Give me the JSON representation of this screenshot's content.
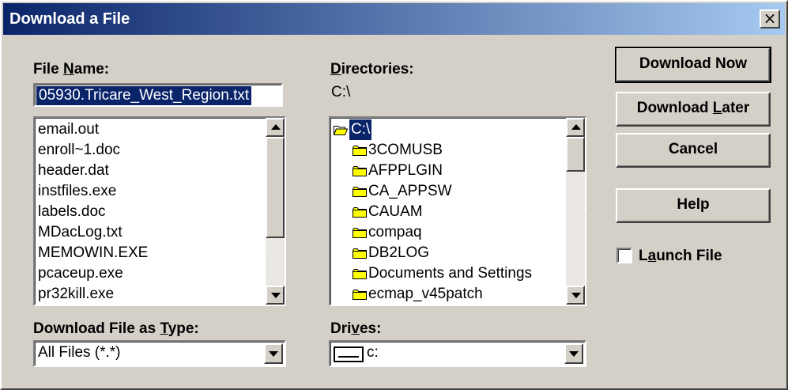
{
  "window": {
    "title": "Download a File",
    "close_label": "×"
  },
  "file_name": {
    "label_pre": "File ",
    "label_ul": "N",
    "label_post": "ame:",
    "value": "05930.Tricare_West_Region.txt"
  },
  "files": [
    "email.out",
    "enroll~1.doc",
    "header.dat",
    "instfiles.exe",
    "labels.doc",
    "MDacLog.txt",
    "MEMOWIN.EXE",
    "pcaceup.exe",
    "pr32kill.exe"
  ],
  "directories": {
    "label_ul": "D",
    "label_post": "irectories:",
    "current_path": "C:\\",
    "items": [
      {
        "name": "C:\\",
        "icon": "open-folder-icon",
        "selected": true
      },
      {
        "name": "3COMUSB",
        "icon": "folder-icon"
      },
      {
        "name": "AFPPLGIN",
        "icon": "folder-icon"
      },
      {
        "name": "CA_APPSW",
        "icon": "folder-icon"
      },
      {
        "name": "CAUAM",
        "icon": "folder-icon"
      },
      {
        "name": "compaq",
        "icon": "folder-icon"
      },
      {
        "name": "DB2LOG",
        "icon": "folder-icon"
      },
      {
        "name": "Documents and Settings",
        "icon": "folder-icon"
      },
      {
        "name": "ecmap_v45patch",
        "icon": "folder-icon"
      }
    ]
  },
  "file_type": {
    "label_pre": "Download File as ",
    "label_ul": "T",
    "label_post": "ype:",
    "selected": "All Files (*.*)"
  },
  "drives": {
    "label_pre": "Dri",
    "label_ul": "v",
    "label_post": "es:",
    "selected": "c:",
    "icon": "drive-icon"
  },
  "buttons": {
    "download_now": "Download Now",
    "download_later_pre": "Download ",
    "download_later_ul": "L",
    "download_later_post": "ater",
    "cancel": "Cancel",
    "help": "Help"
  },
  "launch_file": {
    "label_pre": "L",
    "label_ul": "a",
    "label_post": "unch File",
    "checked": false
  },
  "colors": {
    "title_bar": "#0a246a",
    "face": "#d4d0c8",
    "selection": "#0a246a"
  }
}
